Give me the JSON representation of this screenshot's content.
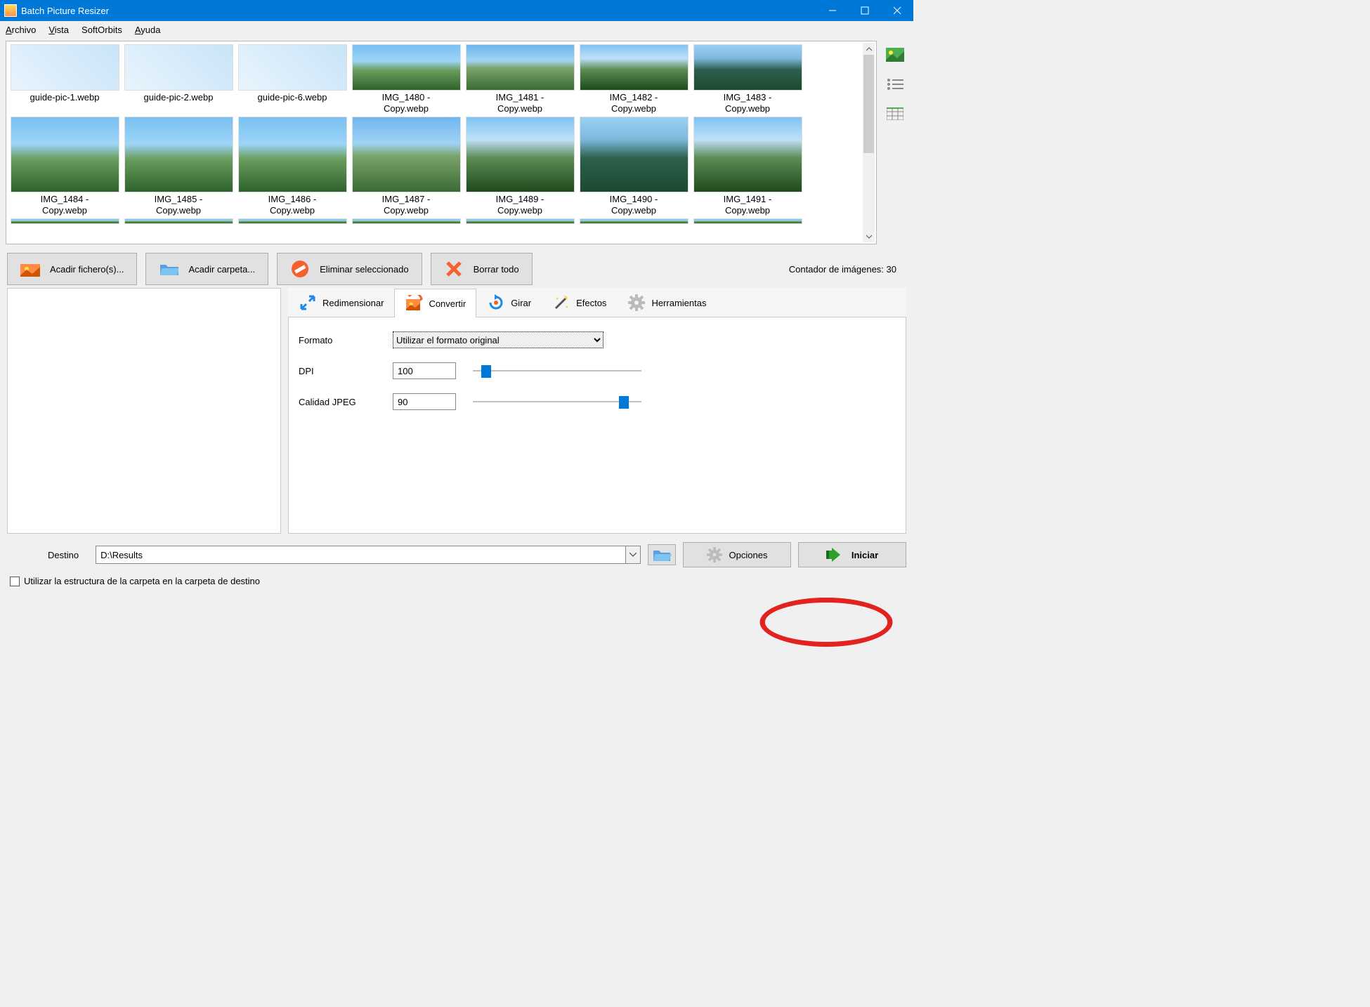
{
  "window": {
    "title": "Batch Picture Resizer"
  },
  "menu": {
    "archivo": "Archivo",
    "vista": "Vista",
    "softorbits": "SoftOrbits",
    "ayuda": "Ayuda"
  },
  "gallery": {
    "row1": [
      "guide-pic-1.webp",
      "guide-pic-2.webp",
      "guide-pic-6.webp",
      "IMG_1480 -\nCopy.webp",
      "IMG_1481 -\nCopy.webp",
      "IMG_1482 -\nCopy.webp",
      "IMG_1483 -\nCopy.webp"
    ],
    "row2": [
      "IMG_1484 -\nCopy.webp",
      "IMG_1485 -\nCopy.webp",
      "IMG_1486 -\nCopy.webp",
      "IMG_1487 -\nCopy.webp",
      "IMG_1489 -\nCopy.webp",
      "IMG_1490 -\nCopy.webp",
      "IMG_1491 -\nCopy.webp"
    ]
  },
  "actions": {
    "add_files": "Acadir fichero(s)...",
    "add_folder": "Acadir carpeta...",
    "remove_selected": "Eliminar seleccionado",
    "clear_all": "Borrar todo"
  },
  "counter": "Contador de imágenes: 30",
  "tabs": {
    "resize": "Redimensionar",
    "convert": "Convertir",
    "rotate": "Girar",
    "effects": "Efectos",
    "tools": "Herramientas"
  },
  "convert_panel": {
    "format_label": "Formato",
    "format_value": "Utilizar el formato original",
    "dpi_label": "DPI",
    "dpi_value": "100",
    "quality_label": "Calidad JPEG",
    "quality_value": "90"
  },
  "bottom": {
    "dest_label": "Destino",
    "dest_value": "D:\\Results",
    "options": "Opciones",
    "start": "Iniciar"
  },
  "checkbox": {
    "label": "Utilizar la estructura de la carpeta en la carpeta de destino"
  }
}
